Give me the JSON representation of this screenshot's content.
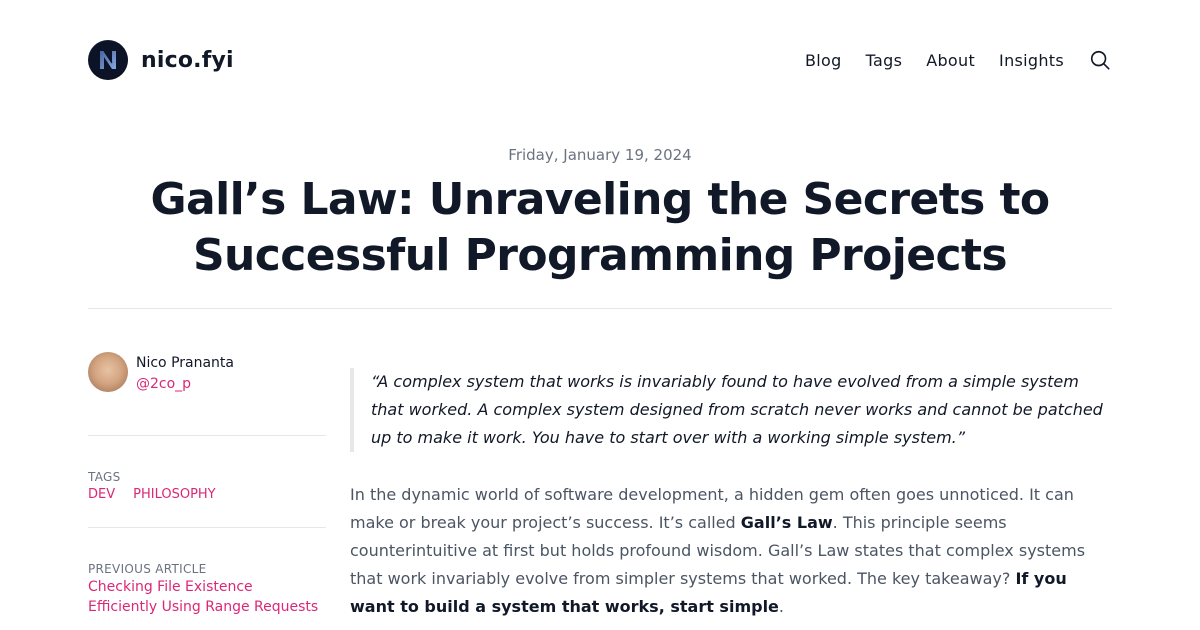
{
  "site": {
    "name": "nico.fyi",
    "logo_icon": "n-logo-icon"
  },
  "nav": {
    "items": [
      "Blog",
      "Tags",
      "About",
      "Insights"
    ],
    "search_icon": "search-icon"
  },
  "post": {
    "date": "Friday, January 19, 2024",
    "title": "Gall’s Law: Unraveling the Secrets to Successful Programming Projects",
    "quote": "“A complex system that works is invariably found to have evolved from a simple system that worked. A complex system designed from scratch never works and cannot be patched up to make it work. You have to start over with a working simple system.”",
    "intro": {
      "p1": "In the dynamic world of software development, a hidden gem often goes unnoticed. It can make or break your project’s success. It’s called ",
      "b1": "Gall’s Law",
      "p2": ". This principle seems counterintuitive at first but holds profound wisdom. Gall’s Law states that complex systems that work invariably evolve from simpler systems that worked. The key takeaway? ",
      "b2": "If you want to build a system that works, start simple",
      "p3": "."
    }
  },
  "author": {
    "name": "Nico Prananta",
    "handle": "@2co_p"
  },
  "sidebar": {
    "tags_label": "TAGS",
    "tags": [
      "DEV",
      "PHILOSOPHY"
    ],
    "prev_label": "PREVIOUS ARTICLE",
    "prev_title": "Checking File Existence Efficiently Using Range Requests"
  },
  "colors": {
    "accent": "#db2777",
    "text": "#111827",
    "muted": "#6b7280",
    "body": "#4b5563",
    "divider": "#e5e7eb"
  }
}
